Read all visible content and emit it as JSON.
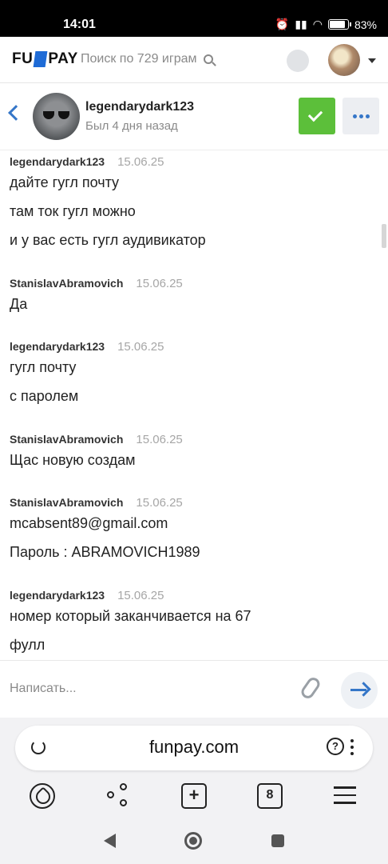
{
  "status_bar": {
    "time": "14:01",
    "battery": "83"
  },
  "site_header": {
    "logo": [
      "FU",
      "PAY"
    ],
    "search_placeholder": "Поиск по 729 играм"
  },
  "chat_header": {
    "peer_name": "legendarydark123",
    "peer_status": "Был 4 дня назад"
  },
  "messages": [
    {
      "author": "legendarydark123",
      "date": "15.06.25",
      "lines": [
        "дайте гугл почту",
        "там ток гугл можно",
        "и у вас есть гугл аудивикатор"
      ]
    },
    {
      "author": "StanislavAbramovich",
      "date": "15.06.25",
      "lines": [
        "Да"
      ]
    },
    {
      "author": "legendarydark123",
      "date": "15.06.25",
      "lines": [
        "гугл почту",
        "с паролем"
      ]
    },
    {
      "author": "StanislavAbramovich",
      "date": "15.06.25",
      "lines": [
        "Щас новую создам"
      ]
    },
    {
      "author": "StanislavAbramovich",
      "date": "15.06.25",
      "lines": [
        "mcabsent89@gmail.com",
        "Пароль : ABRAMOVICH1989"
      ]
    },
    {
      "author": "legendarydark123",
      "date": "15.06.25",
      "lines": [
        "номер который заканчивается на 67",
        "фулл"
      ]
    }
  ],
  "composer": {
    "placeholder": "Написать..."
  },
  "browser": {
    "url": "funpay.com",
    "tab_count": "8"
  },
  "icons": {
    "search": "search-icon",
    "back": "back-arrow-icon",
    "check": "check-icon",
    "more": "more-dots-icon",
    "attach": "paperclip-icon",
    "send": "send-arrow-icon",
    "reload": "reload-icon",
    "ai": "ai-assistant-icon"
  },
  "colors": {
    "accent": "#3576c8",
    "confirm": "#5cbf3a",
    "logo_blue": "#1e6bd6"
  }
}
